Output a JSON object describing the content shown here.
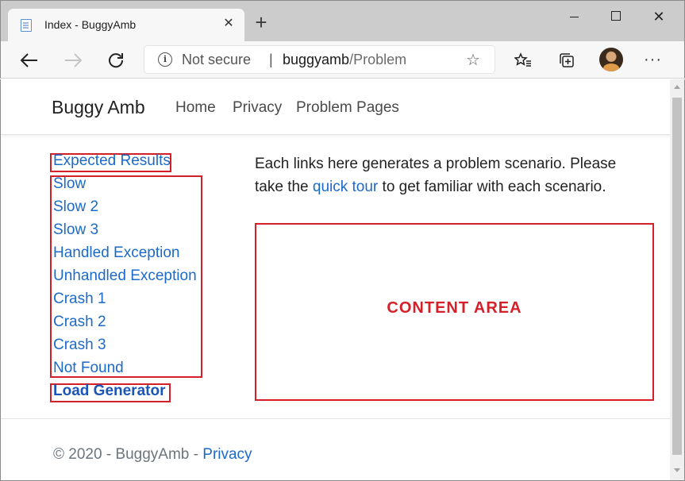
{
  "browser": {
    "tab_title": "Index - BuggyAmb",
    "tab_close": "✕",
    "new_tab": "+",
    "window_close": "✕",
    "address": {
      "security_label": "Not secure",
      "separator": "|",
      "host": "buggyamb",
      "path": "/Problem"
    },
    "icons": {
      "star": "☆",
      "more": "···"
    }
  },
  "site": {
    "brand": "Buggy Amb",
    "nav": {
      "home": "Home",
      "privacy": "Privacy",
      "problem_pages": "Problem Pages"
    }
  },
  "sidebar": {
    "expected_results": "Expected Results",
    "items": [
      "Slow",
      "Slow 2",
      "Slow 3",
      "Handled Exception",
      "Unhandled Exception",
      "Crash 1",
      "Crash 2",
      "Crash 3",
      "Not Found"
    ],
    "load_generator": "Load Generator"
  },
  "main": {
    "intro_before": "Each links here generates a problem scenario. Please take the ",
    "intro_link": "quick tour",
    "intro_after": " to get familiar with each scenario.",
    "content_area_label": "CONTENT AREA"
  },
  "footer": {
    "copyright": "© 2020 - BuggyAmb - ",
    "privacy_link": "Privacy"
  },
  "colors": {
    "link": "#1b6ac9",
    "annotation_red": "#d5202a",
    "tabstrip": "#cccccc",
    "toolbar": "#f7f7f7"
  }
}
